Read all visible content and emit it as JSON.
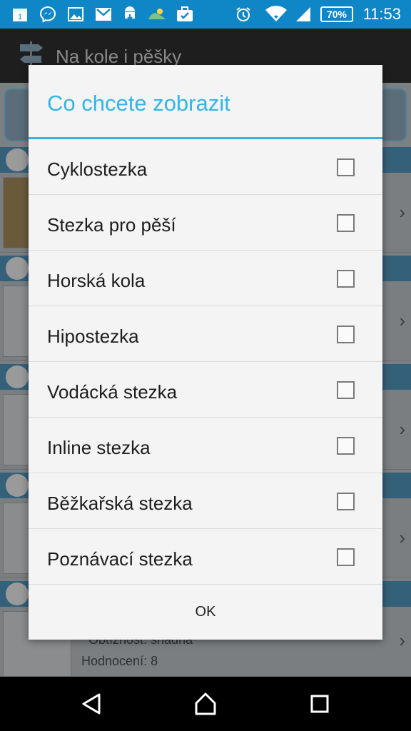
{
  "status_bar": {
    "time": "11:53",
    "battery": "70%",
    "notification_icons": [
      "calendar-icon",
      "messenger-icon",
      "gallery-icon",
      "gmail-icon",
      "android-download-icon",
      "weather-icon",
      "briefcase-icon"
    ],
    "system_icons": [
      "alarm-icon",
      "wifi-icon",
      "signal-icon"
    ]
  },
  "app": {
    "title": "Na kole i pěšky",
    "visible_text": {
      "difficulty": "Obtížnost: snadná",
      "rating": "Hodnocení: 8"
    }
  },
  "dialog": {
    "title": "Co chcete zobrazit",
    "options": [
      {
        "label": "Cyklostezka",
        "checked": false
      },
      {
        "label": "Stezka pro pěší",
        "checked": false
      },
      {
        "label": "Horská kola",
        "checked": false
      },
      {
        "label": "Hipostezka",
        "checked": false
      },
      {
        "label": "Vodácká stezka",
        "checked": false
      },
      {
        "label": "Inline stezka",
        "checked": false
      },
      {
        "label": "Běžkařská stezka",
        "checked": false
      },
      {
        "label": "Poznávací stezka",
        "checked": false
      }
    ],
    "ok_label": "OK"
  },
  "nav_bar": {
    "buttons": [
      "back-icon",
      "home-icon",
      "recents-icon"
    ]
  },
  "colors": {
    "status_bar": "#0f87c7",
    "accent": "#33b5e5",
    "dialog_bg": "#f4f4f4"
  }
}
